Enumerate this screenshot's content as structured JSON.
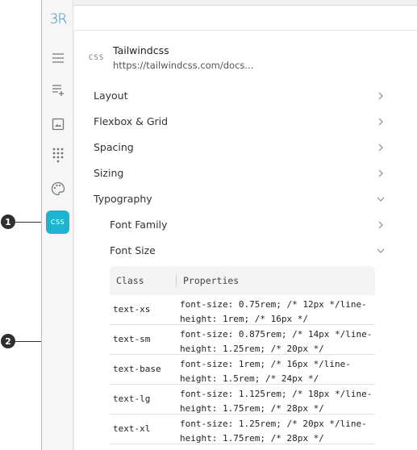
{
  "callouts": [
    {
      "number": "1"
    },
    {
      "number": "2"
    }
  ],
  "rail": {
    "logo": "3R",
    "css_label": "CSS"
  },
  "header": {
    "icon_text": "CSS",
    "title": "Tailwindcss",
    "url": "https://tailwindcss.com/docs..."
  },
  "menu": [
    {
      "label": "Layout",
      "state": "collapsed"
    },
    {
      "label": "Flexbox & Grid",
      "state": "collapsed"
    },
    {
      "label": "Spacing",
      "state": "collapsed"
    },
    {
      "label": "Sizing",
      "state": "collapsed"
    },
    {
      "label": "Typography",
      "state": "expanded"
    }
  ],
  "submenu": [
    {
      "label": "Font Family",
      "state": "collapsed"
    },
    {
      "label": "Font Size",
      "state": "expanded"
    }
  ],
  "table": {
    "headers": [
      "Class",
      "Properties"
    ],
    "rows": [
      {
        "class": "text-xs",
        "properties": "font-size: 0.75rem; /* 12px */line-height: 1rem; /* 16px */"
      },
      {
        "class": "text-sm",
        "properties": "font-size: 0.875rem; /* 14px */line-height: 1.25rem; /* 20px */"
      },
      {
        "class": "text-base",
        "properties": "font-size: 1rem; /* 16px */line-height: 1.5rem; /* 24px */"
      },
      {
        "class": "text-lg",
        "properties": "font-size: 1.125rem; /* 18px */line-height: 1.75rem; /* 28px */"
      },
      {
        "class": "text-xl",
        "properties": "font-size: 1.25rem; /* 20px */line-height: 1.75rem; /* 28px */"
      }
    ]
  },
  "colors": {
    "accent": "#1fb3d2",
    "logo": "#2a8fc7",
    "callout": "#2f2f2f"
  }
}
